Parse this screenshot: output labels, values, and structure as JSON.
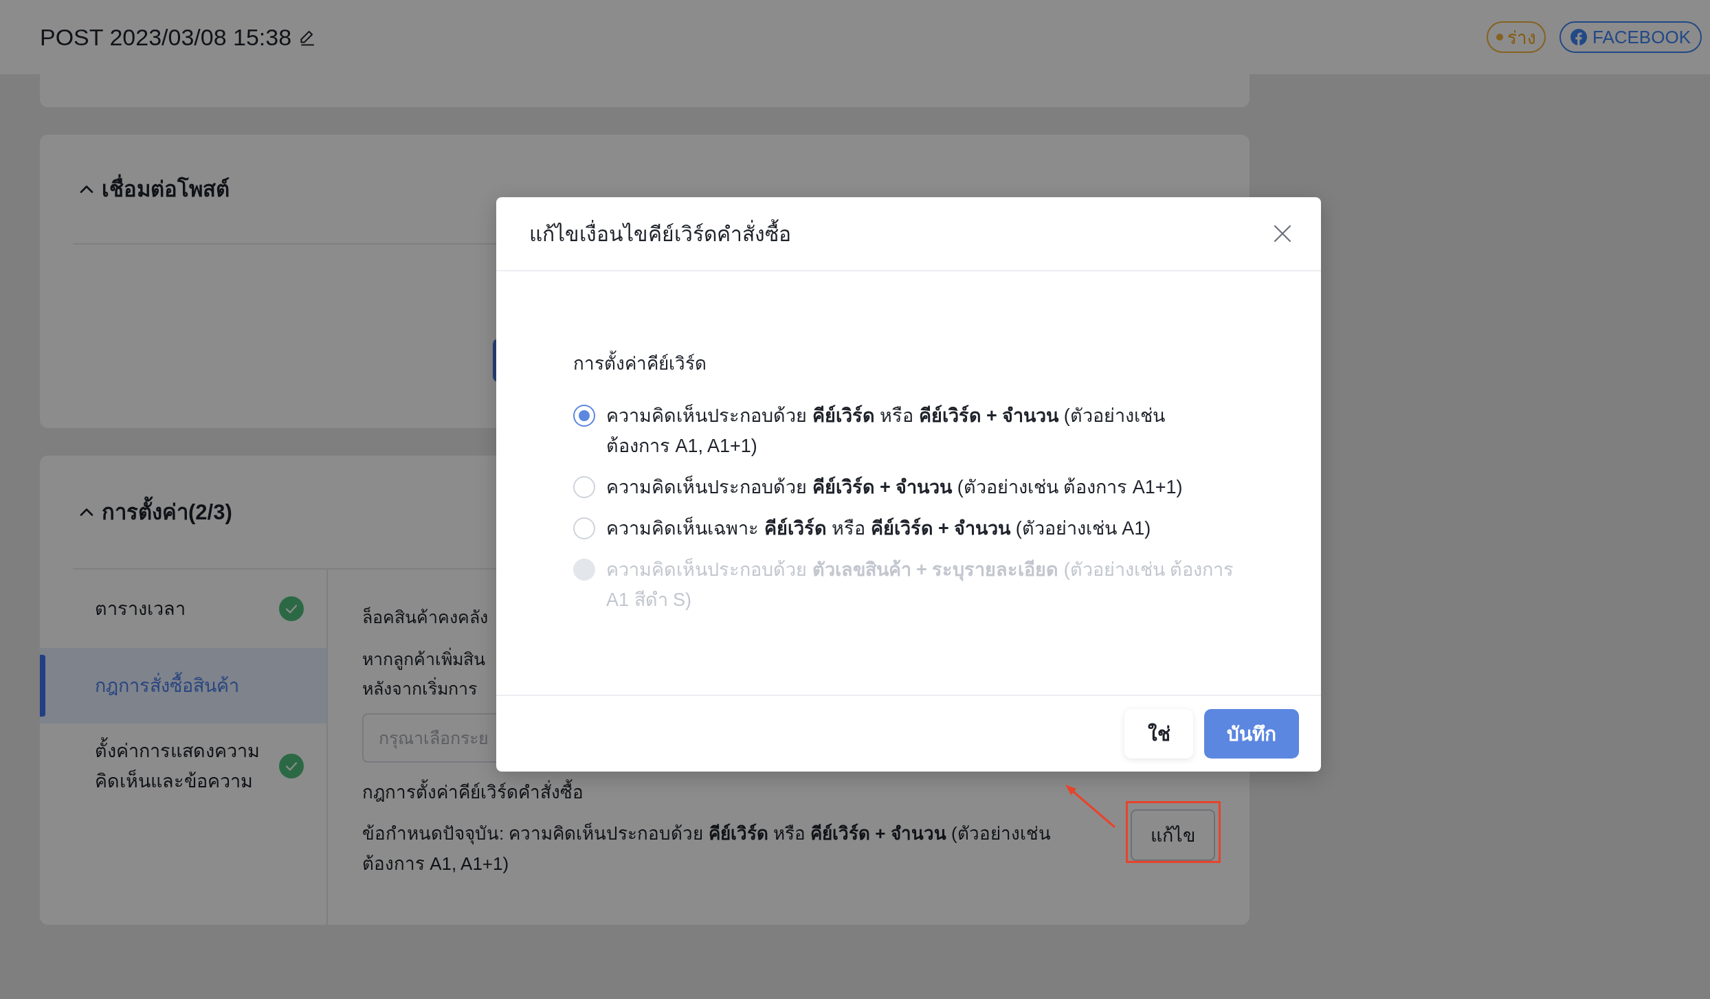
{
  "header": {
    "title": "POST 2023/03/08 15:38",
    "status_badge": {
      "label": "ร่าง"
    },
    "platform_button": {
      "label": "FACEBOOK"
    }
  },
  "sections": [
    {
      "kind": "connect",
      "title": "เชื่อมต่อโพสต์",
      "expanded": true
    },
    {
      "kind": "settings",
      "title": "การตั้งค่า(2/3)",
      "expanded": true,
      "steps": [
        {
          "label": "ตารางเวลา",
          "selected": false,
          "done": true
        },
        {
          "label": "กฎการสั่งซื้อสินค้า",
          "selected": true,
          "done": false
        },
        {
          "label": "ตั้งค่าการแสดงความคิดเห็นและข้อความ",
          "selected": false,
          "done": true
        }
      ],
      "content": {
        "lock_label": "ล็อคสินค้าคงคลัง",
        "description_lines": [
          "หากลูกค้าเพิ่มสิน",
          "หลังจากเริ่มการ"
        ],
        "period_select": {
          "placeholder": "กรุณาเลือกระย"
        },
        "rule_label": "กฎการตั้งค่าคีย์เวิร์ดคำสั่งซื้อ",
        "current_rule": "ข้อกำหนดปัจจุบัน: ความคิดเห็นประกอบด้วย **คีย์เวิร์ด** หรือ **คีย์เวิร์ด + จำนวน** (ตัวอย่างเช่น ต้องการ A1, A1+1)",
        "edit_button": "แก้ไข"
      }
    }
  ],
  "modal": {
    "title": "แก้ไขเงื่อนไขคีย์เวิร์ดคำสั่งซื้อ",
    "field_label": "การตั้งค่าคีย์เวิร์ด",
    "options": [
      {
        "label": "ความคิดเห็นประกอบด้วย **คีย์เวิร์ด** หรือ **คีย์เวิร์ด + จำนวน** (ตัวอย่างเช่น ต้องการ A1, A1+1)",
        "selected": true,
        "disabled": false
      },
      {
        "label": "ความคิดเห็นประกอบด้วย **คีย์เวิร์ด + จำนวน** (ตัวอย่างเช่น ต้องการ A1+1)",
        "selected": false,
        "disabled": false
      },
      {
        "label": "ความคิดเห็นเฉพาะ **คีย์เวิร์ด** หรือ **คีย์เวิร์ด + จำนวน** (ตัวอย่างเช่น A1)",
        "selected": false,
        "disabled": false
      },
      {
        "label": "ความคิดเห็นประกอบด้วย **ตัวเลขสินค้า + ระบุรายละเอียด** (ตัวอย่างเช่น ต้องการ A1 สีดำ S)",
        "selected": false,
        "disabled": true
      }
    ],
    "buttons": [
      {
        "label": "ใช่",
        "kind": "default"
      },
      {
        "label": "บันทึก",
        "kind": "primary"
      }
    ]
  }
}
